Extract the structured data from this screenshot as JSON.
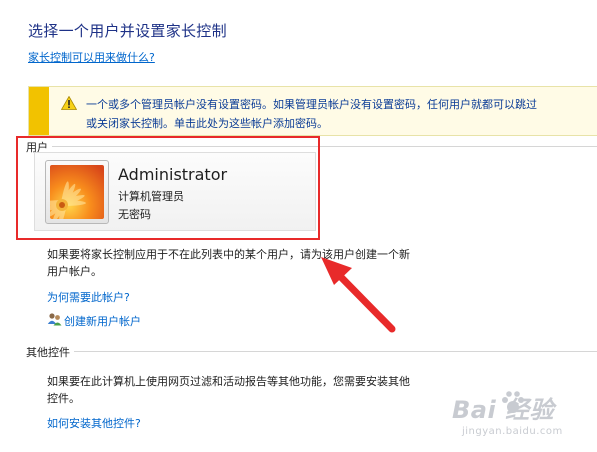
{
  "page": {
    "title": "选择一个用户并设置家长控制",
    "help_link": "家长控制可以用来做什么?"
  },
  "warning": {
    "line1": "一个或多个管理员帐户没有设置密码。如果管理员帐户没有设置密码，任何用户就都可以跳过",
    "line2": "或关闭家长控制。单击此处为这些帐户添加密码。"
  },
  "users_section": {
    "label": "用户",
    "users": [
      {
        "name": "Administrator",
        "role": "计算机管理员",
        "password_status": "无密码"
      }
    ],
    "hint_line1": "如果要将家长控制应用于不在此列表中的某个用户，请为该用户创建一个新",
    "hint_line2": "用户帐户。",
    "why_link": "为何需要此帐户?",
    "create_link": "创建新用户帐户"
  },
  "other_section": {
    "label": "其他控件",
    "text_line1": "如果要在此计算机上使用网页过滤和活动报告等其他功能，您需要安装其他",
    "text_line2": "控件。",
    "install_link": "如何安装其他控件?"
  },
  "watermark": {
    "brand": "Bai 经验",
    "url": "jingyan.baidu.com"
  },
  "colors": {
    "title": "#1e3287",
    "link": "#0066cc",
    "warning_stripe": "#f2c200",
    "highlight": "#e82a2a"
  },
  "icons": [
    "warning-icon",
    "user-avatar-flower",
    "add-users-icon",
    "red-arrow",
    "baidu-paw-icon"
  ]
}
